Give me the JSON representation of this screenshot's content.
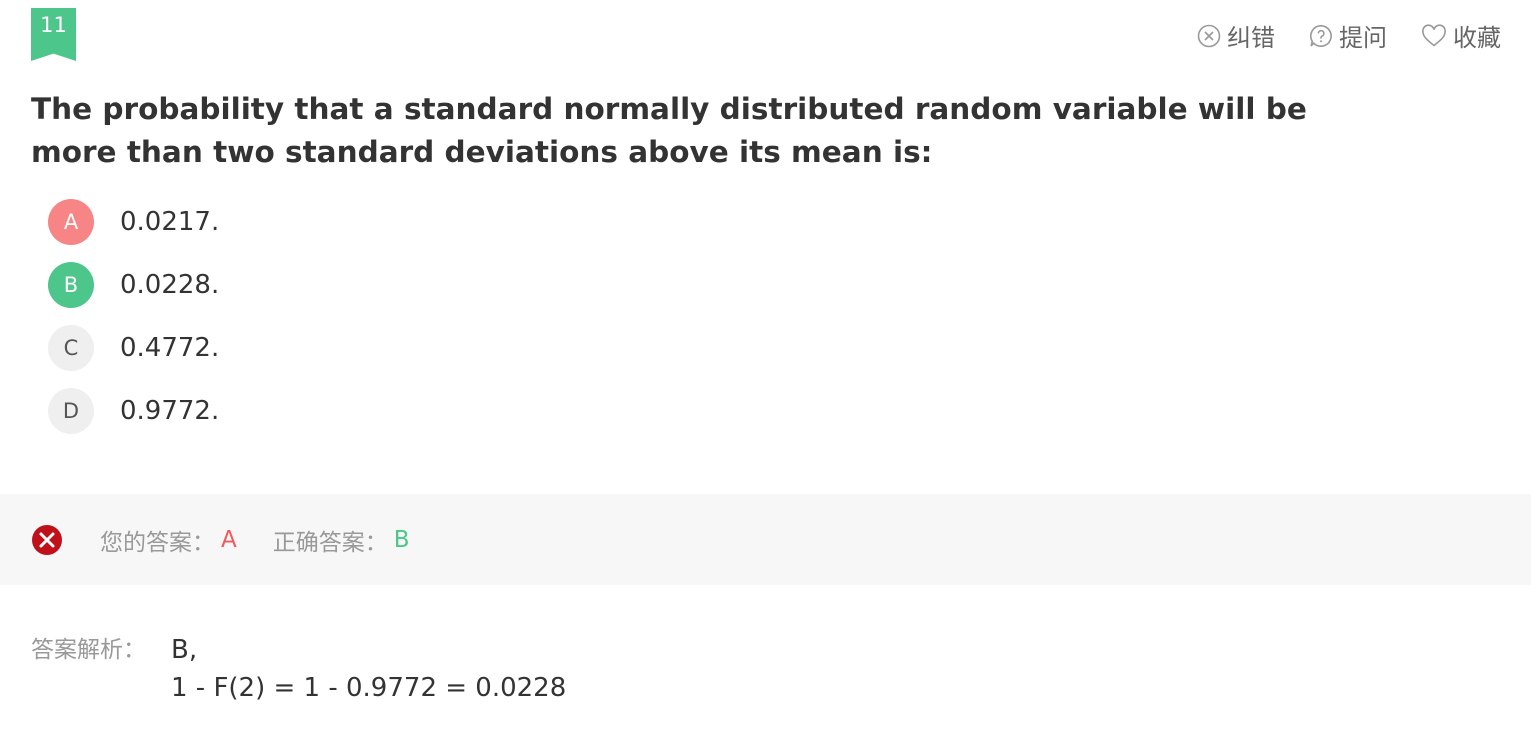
{
  "question": {
    "number": "11",
    "text": "The probability that a standard normally distributed random variable will be more than two standard deviations above its mean is:"
  },
  "tools": [
    {
      "label": "纠错",
      "icon": "close-circle-icon"
    },
    {
      "label": "提问",
      "icon": "question-bubble-icon"
    },
    {
      "label": "收藏",
      "icon": "heart-icon"
    }
  ],
  "options": [
    {
      "letter": "A",
      "text": "0.0217.",
      "state": "wrong"
    },
    {
      "letter": "B",
      "text": "0.0228.",
      "state": "correct"
    },
    {
      "letter": "C",
      "text": "0.4772.",
      "state": "normal"
    },
    {
      "letter": "D",
      "text": "0.9772.",
      "state": "normal"
    }
  ],
  "result": {
    "your_answer_label": "您的答案：",
    "your_answer": "A",
    "correct_answer_label": "正确答案：",
    "correct_answer": "B"
  },
  "analysis": {
    "label": "答案解析：",
    "line1": "B,",
    "line2": "1 - F(2) = 1 - 0.9772 = 0.0228"
  },
  "colors": {
    "accent_green": "#4cc68a",
    "wrong_red": "#f78585",
    "answer_red": "#f05a5a",
    "error_icon": "#c0111a"
  }
}
